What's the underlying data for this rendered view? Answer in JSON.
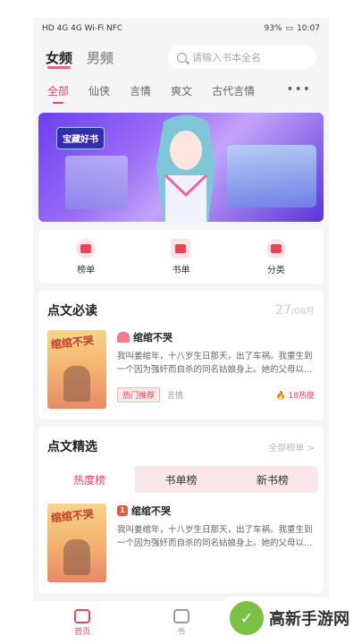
{
  "status": {
    "left_icons": "HD 4G 4G Wi-Fi NFC",
    "battery": "93%",
    "time": "10:07"
  },
  "top": {
    "tabs": [
      "女频",
      "男频"
    ],
    "search_placeholder": "请输入书本全名"
  },
  "categories": [
    "全部",
    "仙侠",
    "言情",
    "爽文",
    "古代言情"
  ],
  "banner": {
    "badge": "宝藏好书"
  },
  "quick": {
    "items": [
      {
        "label": "榜单",
        "icon": "crown-icon"
      },
      {
        "label": "书单",
        "icon": "list-icon"
      },
      {
        "label": "分类",
        "icon": "pie-icon"
      }
    ]
  },
  "must_read": {
    "title": "点文必读",
    "date_day": "27",
    "date_month": "/08月",
    "book": {
      "cover_title": "绾绾不哭",
      "title": "绾绾不哭",
      "desc": "我叫姜绾年，十八岁生日那天，出了车祸。我重生到一个因为强奸而自杀的同名姑娘身上。她的父母以…",
      "tag": "热门推荐",
      "genre": "言情",
      "heat": "18热度"
    }
  },
  "featured": {
    "title": "点文精选",
    "all": "全部榜单 >",
    "tabs": [
      "热度榜",
      "书单榜",
      "新书榜"
    ],
    "book": {
      "rank": "1",
      "cover_title": "绾绾不哭",
      "title": "绾绾不哭",
      "desc": "我叫姜绾年，十八岁生日那天，出了车祸。我重生到一个因为强奸而自杀的同名姑娘身上。她的父母以…"
    }
  },
  "tabbar": {
    "items": [
      {
        "label": "首页"
      },
      {
        "label": "书"
      },
      {
        "label": ""
      }
    ]
  },
  "watermark": {
    "text": "高新手游网"
  }
}
